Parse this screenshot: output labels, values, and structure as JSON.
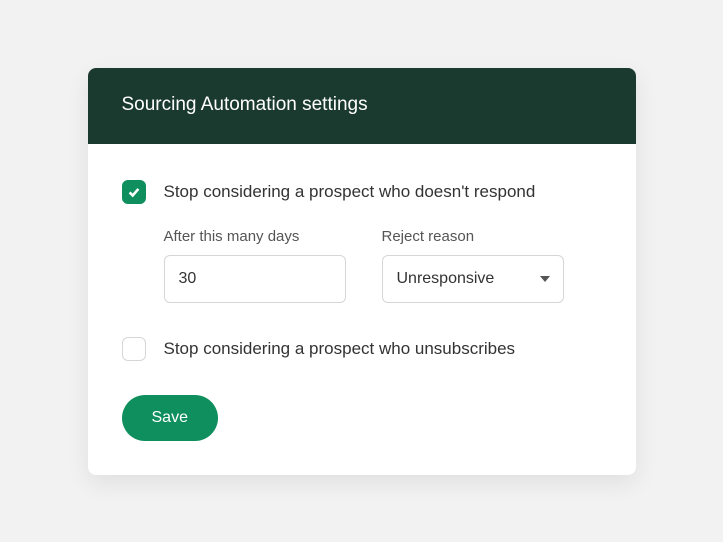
{
  "header": {
    "title": "Sourcing Automation settings"
  },
  "settings": {
    "stopNoResponse": {
      "checked": true,
      "label": "Stop considering a prospect who doesn't respond",
      "daysLabel": "After this many days",
      "daysValue": "30",
      "reasonLabel": "Reject reason",
      "reasonValue": "Unresponsive"
    },
    "stopUnsubscribe": {
      "checked": false,
      "label": "Stop considering a prospect who unsubscribes"
    }
  },
  "actions": {
    "saveLabel": "Save"
  }
}
